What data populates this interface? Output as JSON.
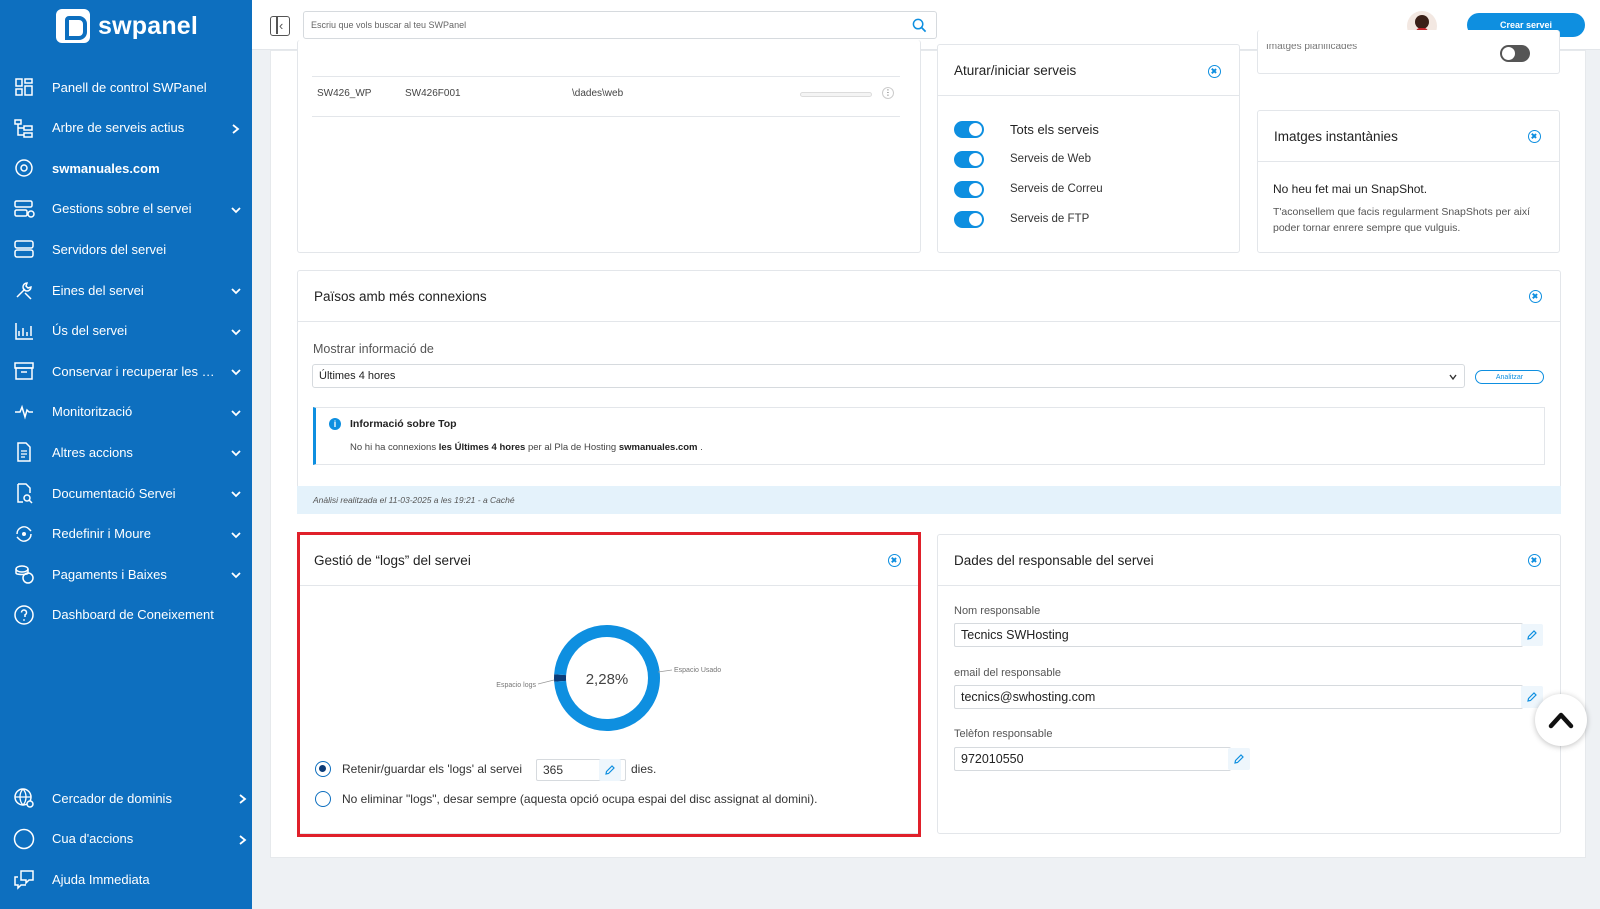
{
  "brand": {
    "name": "swpanel"
  },
  "sidebar": {
    "items": [
      {
        "label": "Panell de control SWPanel",
        "icon": "dashboard-icon",
        "chevron": ""
      },
      {
        "label": "Arbre de serveis actius",
        "icon": "tree-icon",
        "chevron": "right"
      },
      {
        "label": "swmanuales.com",
        "icon": "globe-target-icon",
        "chevron": "",
        "bold": true
      },
      {
        "label": "Gestions sobre el servei",
        "icon": "server-gear-icon",
        "chevron": "down"
      },
      {
        "label": "Servidors del servei",
        "icon": "servers-icon",
        "chevron": ""
      },
      {
        "label": "Eines del servei",
        "icon": "tools-icon",
        "chevron": "down"
      },
      {
        "label": "Ús del servei",
        "icon": "chart-icon",
        "chevron": "down"
      },
      {
        "label": "Conservar i recuperar les mev...",
        "icon": "archive-icon",
        "chevron": "down"
      },
      {
        "label": "Monitorització",
        "icon": "pulse-icon",
        "chevron": "down"
      },
      {
        "label": "Altres accions",
        "icon": "document-icon",
        "chevron": "down"
      },
      {
        "label": "Documentació Servei",
        "icon": "doc-search-icon",
        "chevron": "down"
      },
      {
        "label": "Redefinir i Moure",
        "icon": "refresh-icon",
        "chevron": "down"
      },
      {
        "label": "Pagaments i Baixes",
        "icon": "coins-icon",
        "chevron": "down"
      },
      {
        "label": "Dashboard de Coneixement",
        "icon": "help-icon",
        "chevron": ""
      }
    ],
    "bottom_items": [
      {
        "label": "Cercador de dominis",
        "icon": "globe-search-icon",
        "chevron": "right"
      },
      {
        "label": "Cua d'accions",
        "icon": "circle-icon",
        "chevron": "right"
      },
      {
        "label": "Ajuda Immediata",
        "icon": "chat-icon",
        "chevron": ""
      }
    ]
  },
  "topbar": {
    "search_placeholder": "Escriu que vols buscar al teu SWPanel",
    "create_button": "Crear servei"
  },
  "table_fragment": {
    "row": [
      "SW426_WP",
      "SW426F001",
      "\\dades\\web"
    ],
    "progress": 0
  },
  "services_card": {
    "title": "Aturar/iniciar serveis",
    "toggles": [
      {
        "label": "Tots els serveis",
        "on": true
      },
      {
        "label": "Serveis de Web",
        "on": true
      },
      {
        "label": "Serveis de Correu",
        "on": true
      },
      {
        "label": "Serveis de FTP",
        "on": true
      }
    ]
  },
  "planned_images": {
    "label": "Imatges planificades",
    "on": false
  },
  "snapshots_card": {
    "title": "Imatges instantànies",
    "heading": "No heu fet mai un SnapShot.",
    "text": "T'aconsellem que facis regularment SnapShots per així poder tornar enrere sempre que vulguis."
  },
  "countries_card": {
    "title": "Països amb més connexions",
    "show_label": "Mostrar informació de",
    "selected": "Últimes 4 hores",
    "analyze_button": "Analitzar",
    "info_title": "Informació sobre Top",
    "info_prefix": "No hi ha connexions",
    "info_bold1": "les Últimes 4 hores",
    "info_mid": "per al Pla de Hosting",
    "info_bold2": "swmanuales.com",
    "info_suffix": ".",
    "cache_note": "Anàlisi realitzada el 11-03-2025 a les 19:21 - a Caché"
  },
  "logs_card": {
    "title": "Gestió de “logs” del servei",
    "chart_center": "2,28%",
    "label_logs": "Espacio logs",
    "label_used": "Espacio Usado",
    "retain_label": "Retenir/guardar els 'logs' al servei",
    "retain_days": "365",
    "days_unit": "dies.",
    "no_delete_label": "No eliminar \"logs\", desar sempre (aquesta opció ocupa espai del disc assignat al domini).",
    "retain_selected": true
  },
  "chart_data": {
    "type": "pie",
    "title": "",
    "categories": [
      "Espacio logs",
      "Espacio Usado"
    ],
    "values": [
      2.28,
      97.72
    ],
    "center_label": "2,28%",
    "colors": [
      "#0d3c78",
      "#0e8fe0"
    ]
  },
  "owner_card": {
    "title": "Dades del responsable del servei",
    "name_label": "Nom responsable",
    "name_value": "Tecnics SWHosting",
    "email_label": "email del responsable",
    "email_value": "tecnics@swhosting.com",
    "phone_label": "Telèfon responsable",
    "phone_value": "972010550"
  },
  "colors": {
    "sidebar": "#0d6fbf",
    "accent": "#0e8fe0",
    "highlight": "#e0202a"
  }
}
